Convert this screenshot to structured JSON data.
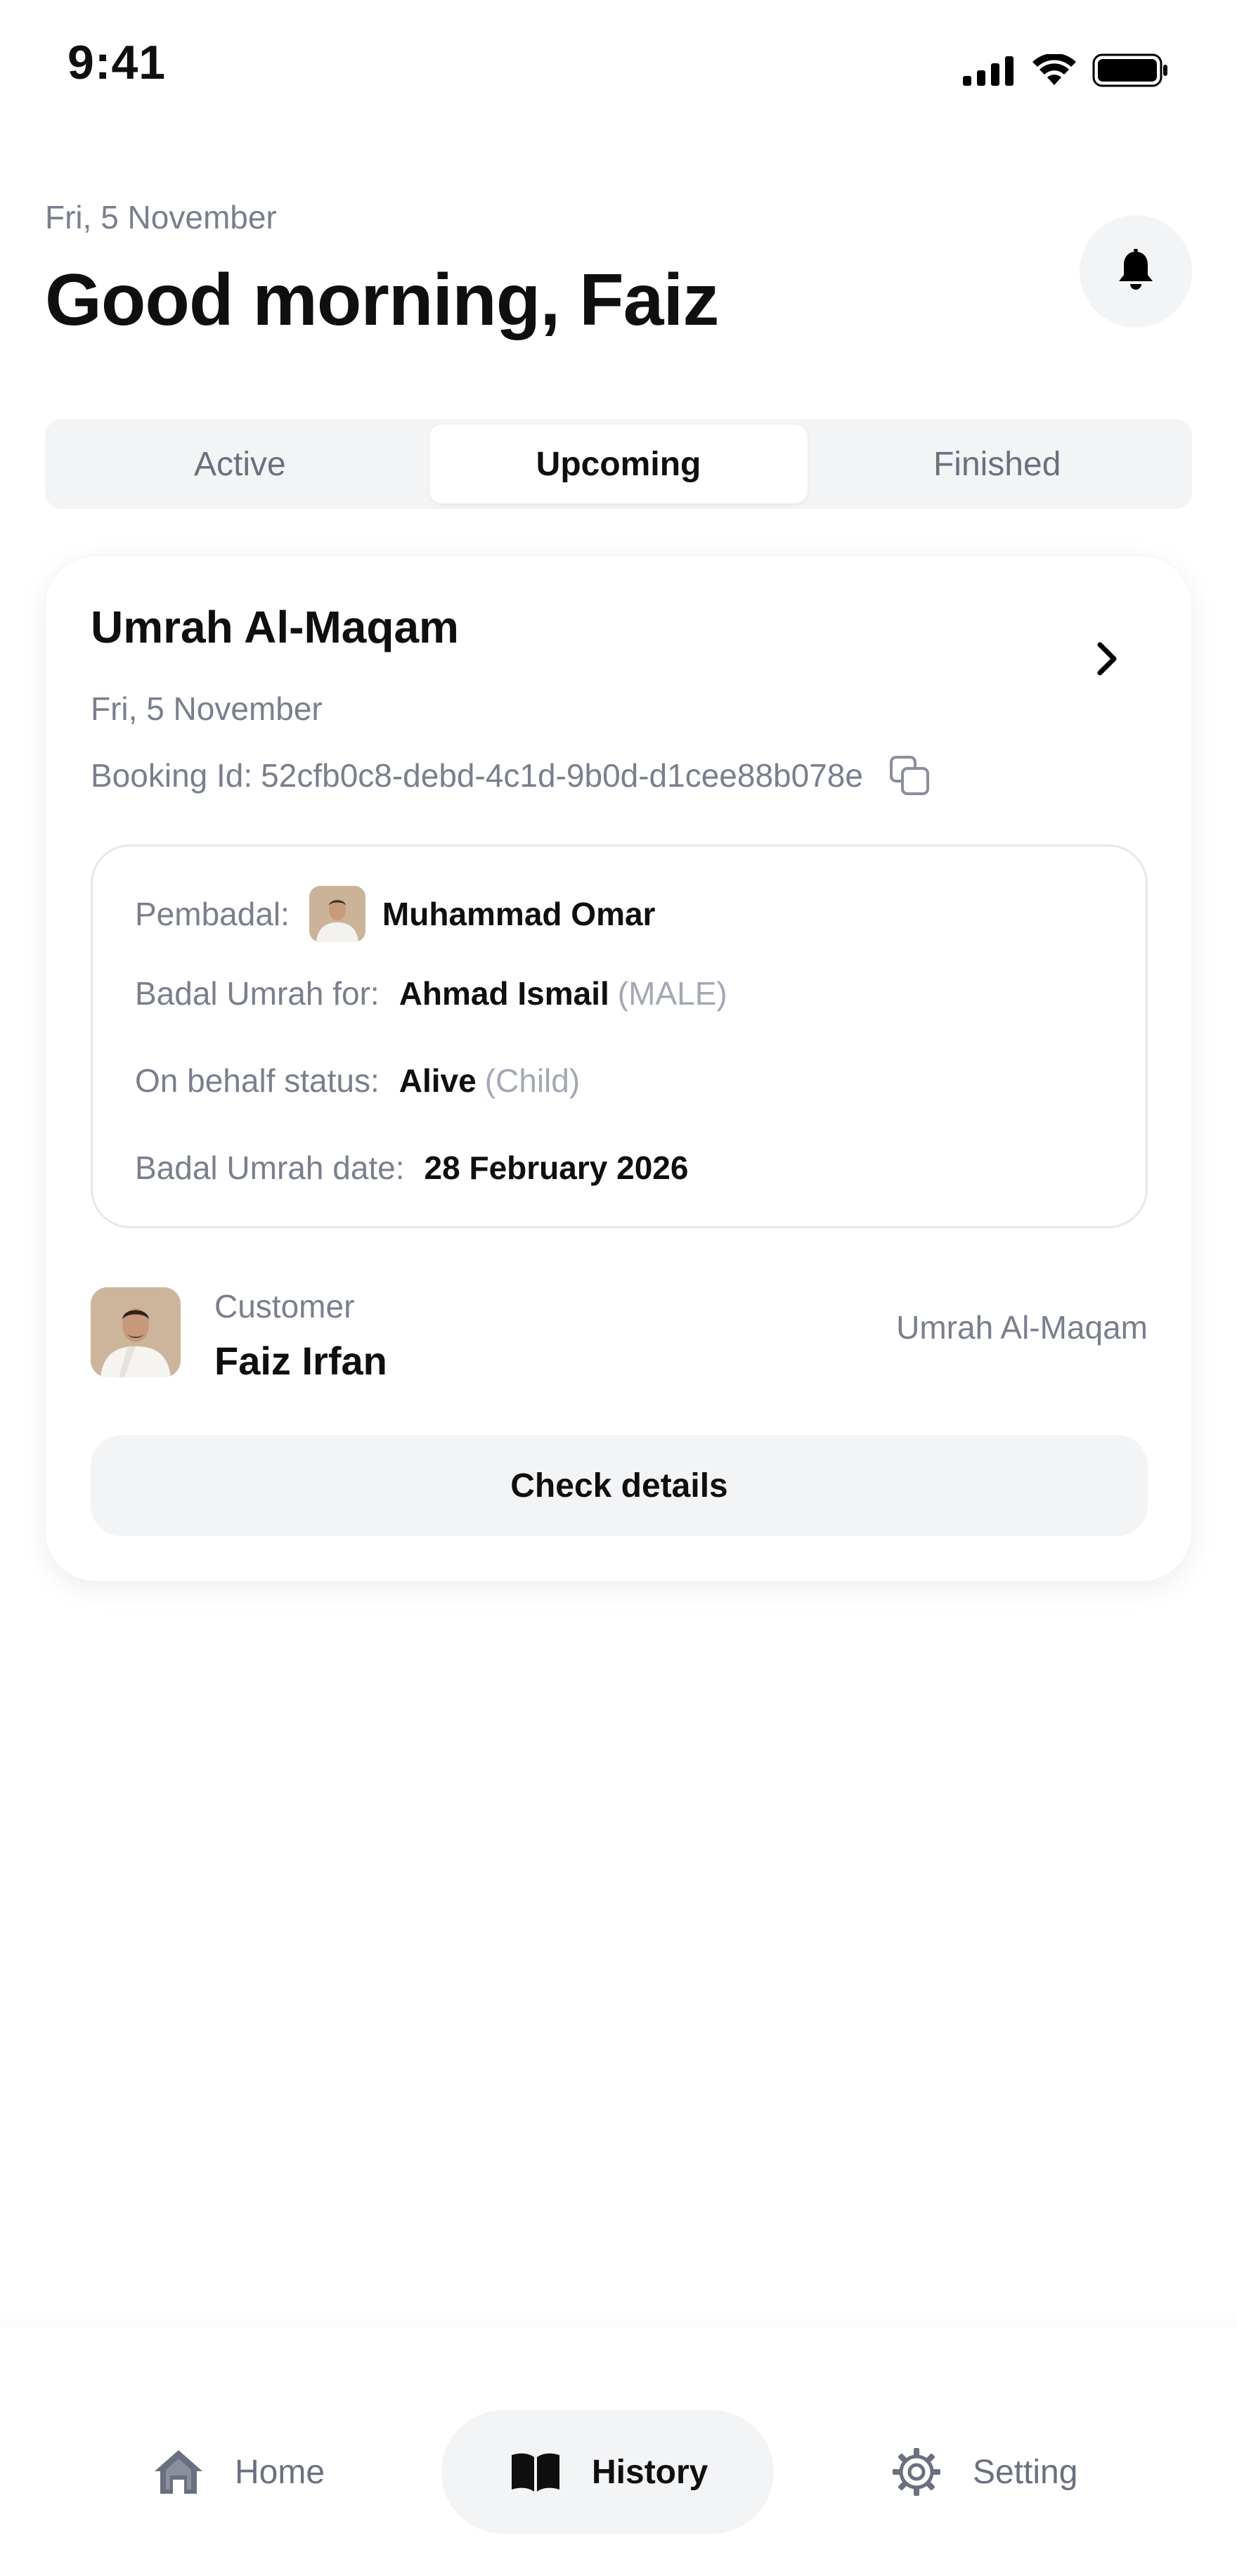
{
  "status_bar": {
    "time": "9:41"
  },
  "header": {
    "date": "Fri, 5 November",
    "greeting": "Good morning, Faiz"
  },
  "tabs": [
    {
      "label": "Active",
      "selected": false
    },
    {
      "label": "Upcoming",
      "selected": true
    },
    {
      "label": "Finished",
      "selected": false
    }
  ],
  "booking": {
    "title": "Umrah Al-Maqam",
    "date": "Fri, 5 November",
    "booking_id_label": "Booking Id:",
    "booking_id": "52cfb0c8-debd-4c1d-9b0d-d1cee88b078e",
    "details": {
      "pembadal_label": "Pembadal:",
      "pembadal_name": "Muhammad Omar",
      "badal_for_label": "Badal Umrah for:",
      "badal_for_name": "Ahmad Ismail",
      "badal_for_gender": "(MALE)",
      "status_label": "On behalf status:",
      "status_value": "Alive",
      "status_relation": "(Child)",
      "date_label": "Badal Umrah date:",
      "date_value": "28 February 2026"
    },
    "customer": {
      "label": "Customer",
      "name": "Faiz Irfan",
      "package": "Umrah Al-Maqam"
    },
    "action_label": "Check details"
  },
  "bottom_nav": [
    {
      "label": "Home",
      "icon": "home-icon",
      "active": false
    },
    {
      "label": "History",
      "icon": "book-icon",
      "active": true
    },
    {
      "label": "Setting",
      "icon": "gear-icon",
      "active": false
    }
  ]
}
